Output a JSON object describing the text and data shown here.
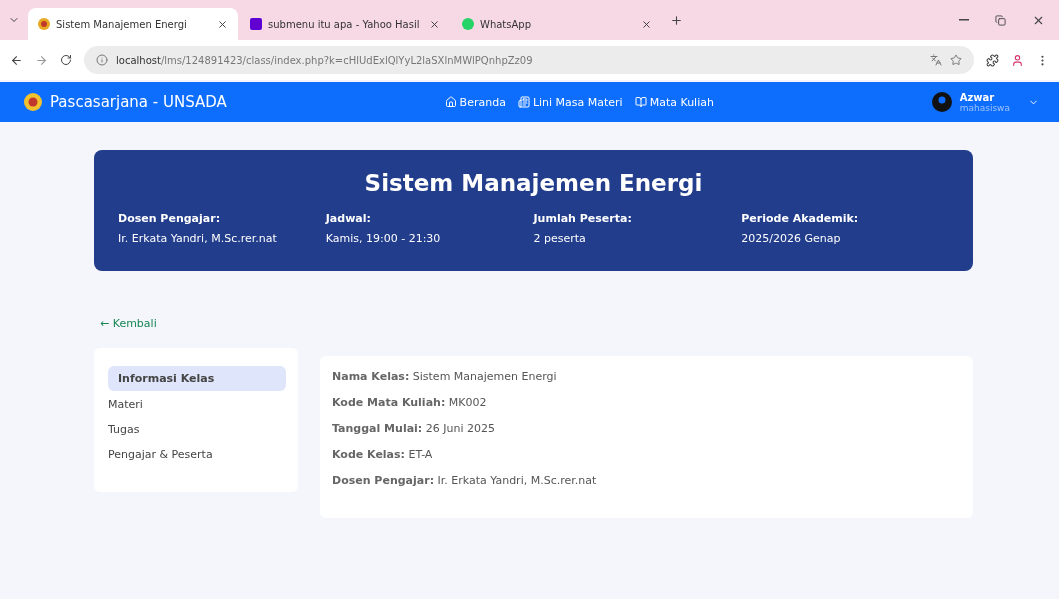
{
  "browser": {
    "tabs": [
      {
        "title": "Sistem Manajemen Energi",
        "kind": "logo",
        "selected": true
      },
      {
        "title": "submenu itu apa - Yahoo Hasil",
        "kind": "yahoo",
        "selected": false
      },
      {
        "title": "WhatsApp",
        "kind": "whatsapp",
        "selected": false
      }
    ],
    "address": {
      "host": "localhost",
      "path": "/lms/124891423/class/index.php?k=cHlUdExlQlYyL2laSXlnMWlPQnhpZz09"
    }
  },
  "navbar": {
    "brand": "Pascasarjana - UNSADA",
    "links": [
      {
        "label": "Beranda",
        "kind": "home"
      },
      {
        "label": "Lini Masa Materi",
        "kind": "timeline"
      },
      {
        "label": "Mata Kuliah",
        "kind": "book"
      }
    ],
    "user": {
      "name": "Azwar",
      "role": "mahasiswa"
    }
  },
  "banner": {
    "title": "Sistem Manajemen Energi",
    "facts": [
      {
        "label": "Dosen Pengajar:",
        "value": "Ir. Erkata Yandri, M.Sc.rer.nat"
      },
      {
        "label": "Jadwal:",
        "value": "Kamis, 19:00 - 21:30"
      },
      {
        "label": "Jumlah Peserta:",
        "value": "2 peserta"
      },
      {
        "label": "Periode Akademik:",
        "value": "2025/2026 Genap"
      }
    ]
  },
  "back_link": "← Kembali",
  "sidebar": {
    "items": [
      {
        "label": "Informasi Kelas",
        "selected": true
      },
      {
        "label": "Materi",
        "selected": false
      },
      {
        "label": "Tugas",
        "selected": false
      },
      {
        "label": "Pengajar & Peserta",
        "selected": false
      }
    ]
  },
  "info": [
    "**Nama Kelas:** Sistem Manajemen Energi",
    "**Kode Mata Kuliah:** MK002",
    "**Tanggal Mulai:** 26 Juni 2025",
    "**Kode Kelas:** ET-A",
    "**Dosen Pengajar:** Ir. Erkata Yandri, M.Sc.rer.nat"
  ]
}
